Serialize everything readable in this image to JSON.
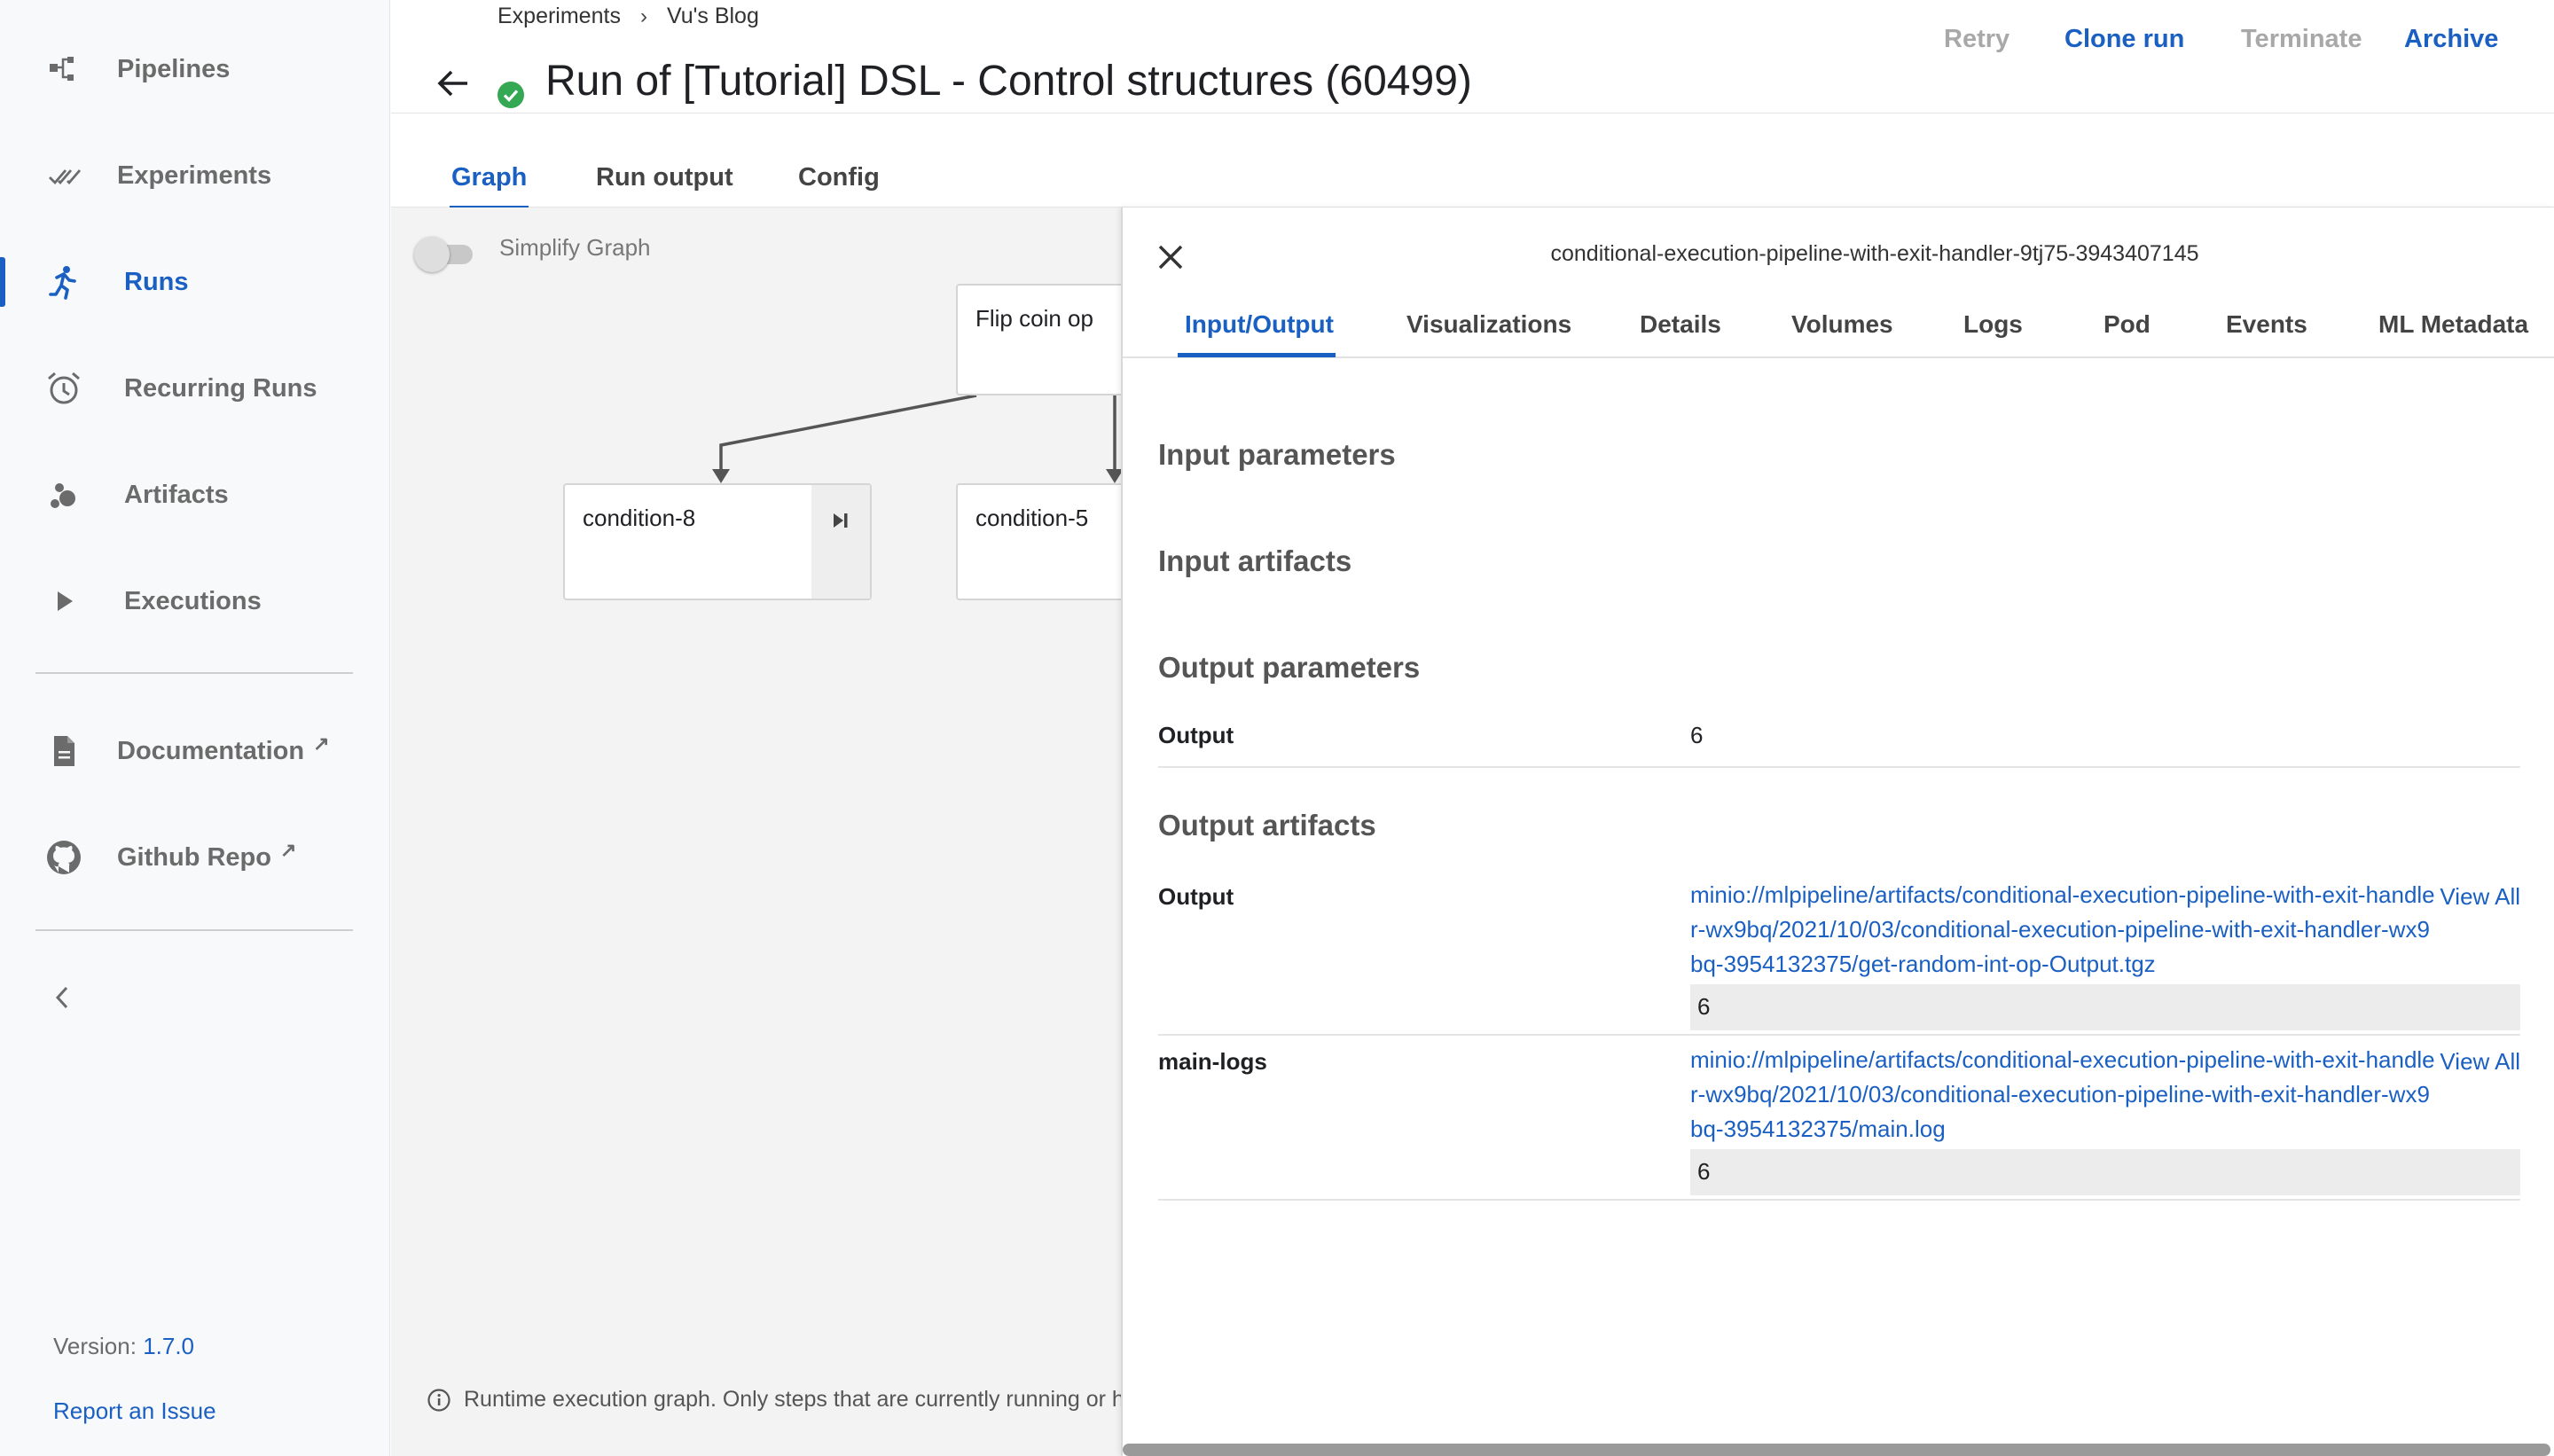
{
  "sidebar": {
    "items": [
      {
        "label": "Pipelines",
        "icon": "pipelines-icon"
      },
      {
        "label": "Experiments",
        "icon": "experiments-icon"
      },
      {
        "label": "Runs",
        "icon": "runs-icon",
        "active": true
      },
      {
        "label": "Recurring Runs",
        "icon": "recurring-runs-icon"
      },
      {
        "label": "Artifacts",
        "icon": "artifacts-icon"
      },
      {
        "label": "Executions",
        "icon": "executions-icon"
      }
    ],
    "links": [
      {
        "label": "Documentation",
        "icon": "document-icon"
      },
      {
        "label": "Github Repo",
        "icon": "github-icon"
      }
    ],
    "version_label": "Version:",
    "version_number": "1.7.0",
    "report_issue": "Report an Issue"
  },
  "header": {
    "breadcrumb": [
      "Experiments",
      "Vu's Blog"
    ],
    "breadcrumb_separator": "›",
    "title": "Run of [Tutorial] DSL - Control structures (60499)",
    "status": "succeeded",
    "actions": {
      "retry": "Retry",
      "clone_run": "Clone run",
      "terminate": "Terminate",
      "archive": "Archive"
    }
  },
  "tabs": [
    "Graph",
    "Run output",
    "Config"
  ],
  "graph": {
    "simplify_label": "Simplify Graph",
    "nodes": {
      "flip": "Flip coin op",
      "cond8": "condition-8",
      "cond5": "condition-5"
    },
    "footer_note": "Runtime execution graph. Only steps that are currently running or have already completed are shown."
  },
  "panel": {
    "title": "conditional-execution-pipeline-with-exit-handler-9tj75-3943407145",
    "tabs": [
      "Input/Output",
      "Visualizations",
      "Details",
      "Volumes",
      "Logs",
      "Pod",
      "Events",
      "ML Metadata"
    ],
    "input_parameters_heading": "Input parameters",
    "input_artifacts_heading": "Input artifacts",
    "output_parameters_heading": "Output parameters",
    "output_parameters": [
      {
        "key": "Output",
        "value": "6"
      }
    ],
    "output_artifacts_heading": "Output artifacts",
    "output_artifacts": [
      {
        "key": "Output",
        "uri": "minio://mlpipeline/artifacts/conditional-execution-pipeline-with-exit-handler-wx9bq/2021/10/03/conditional-execution-pipeline-with-exit-handler-wx9bq-3954132375/get-random-int-op-Output.tgz",
        "view_all": "View All",
        "preview": "6"
      },
      {
        "key": "main-logs",
        "uri": "minio://mlpipeline/artifacts/conditional-execution-pipeline-with-exit-handler-wx9bq/2021/10/03/conditional-execution-pipeline-with-exit-handler-wx9bq-3954132375/main.log",
        "view_all": "View All",
        "preview": "6"
      }
    ]
  },
  "colors": {
    "accent": "#1a5fc2",
    "success": "#34a853",
    "disabled": "#a8a8a8"
  }
}
